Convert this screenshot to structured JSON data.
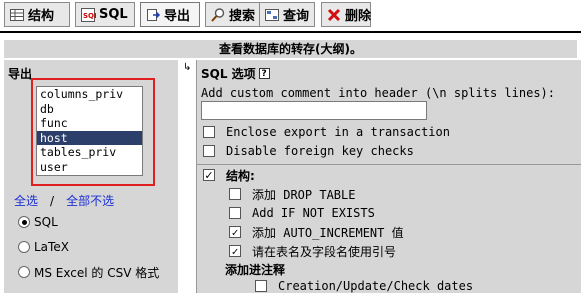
{
  "tabs": [
    {
      "label": "结构",
      "icon": "structure-icon"
    },
    {
      "label": "SQL",
      "icon": "sql-icon"
    },
    {
      "label": "导出",
      "icon": "export-icon",
      "active": true
    },
    {
      "label": "搜索",
      "icon": "search-icon"
    },
    {
      "label": "查询",
      "icon": "query-icon"
    },
    {
      "label": "删除",
      "icon": "delete-icon"
    }
  ],
  "title": "查看数据库的转存(大纲)。",
  "export": {
    "legend": "导出",
    "tables": [
      "columns_priv",
      "db",
      "func",
      "host",
      "tables_priv",
      "user"
    ],
    "selected_table": "host",
    "select_all": "全选",
    "separator": "/",
    "deselect_all": "全部不选",
    "formats": [
      {
        "label": "SQL",
        "checked": true
      },
      {
        "label": "LaTeX",
        "checked": false
      },
      {
        "label": "MS Excel 的 CSV 格式",
        "checked": false
      }
    ]
  },
  "arrow": "↳",
  "sql_options": {
    "heading": "SQL 选项",
    "help": "?",
    "comment_label": "Add custom comment into header (\\n splits lines):",
    "comment_value": "",
    "enclose_transaction": {
      "label": "Enclose export in a transaction",
      "checked": false
    },
    "disable_fk": {
      "label": "Disable foreign key checks",
      "checked": false
    },
    "structure": {
      "label": "结构:",
      "checked": true,
      "options": [
        {
          "label": "添加 DROP TABLE",
          "checked": false
        },
        {
          "label": "Add IF NOT EXISTS",
          "checked": false
        },
        {
          "label": "添加 AUTO_INCREMENT 值",
          "checked": true
        },
        {
          "label": "请在表名及字段名使用引号",
          "checked": true
        }
      ]
    },
    "comments_label": "添加进注释",
    "creation_dates": {
      "label": "Creation/Update/Check dates",
      "checked": false
    }
  }
}
